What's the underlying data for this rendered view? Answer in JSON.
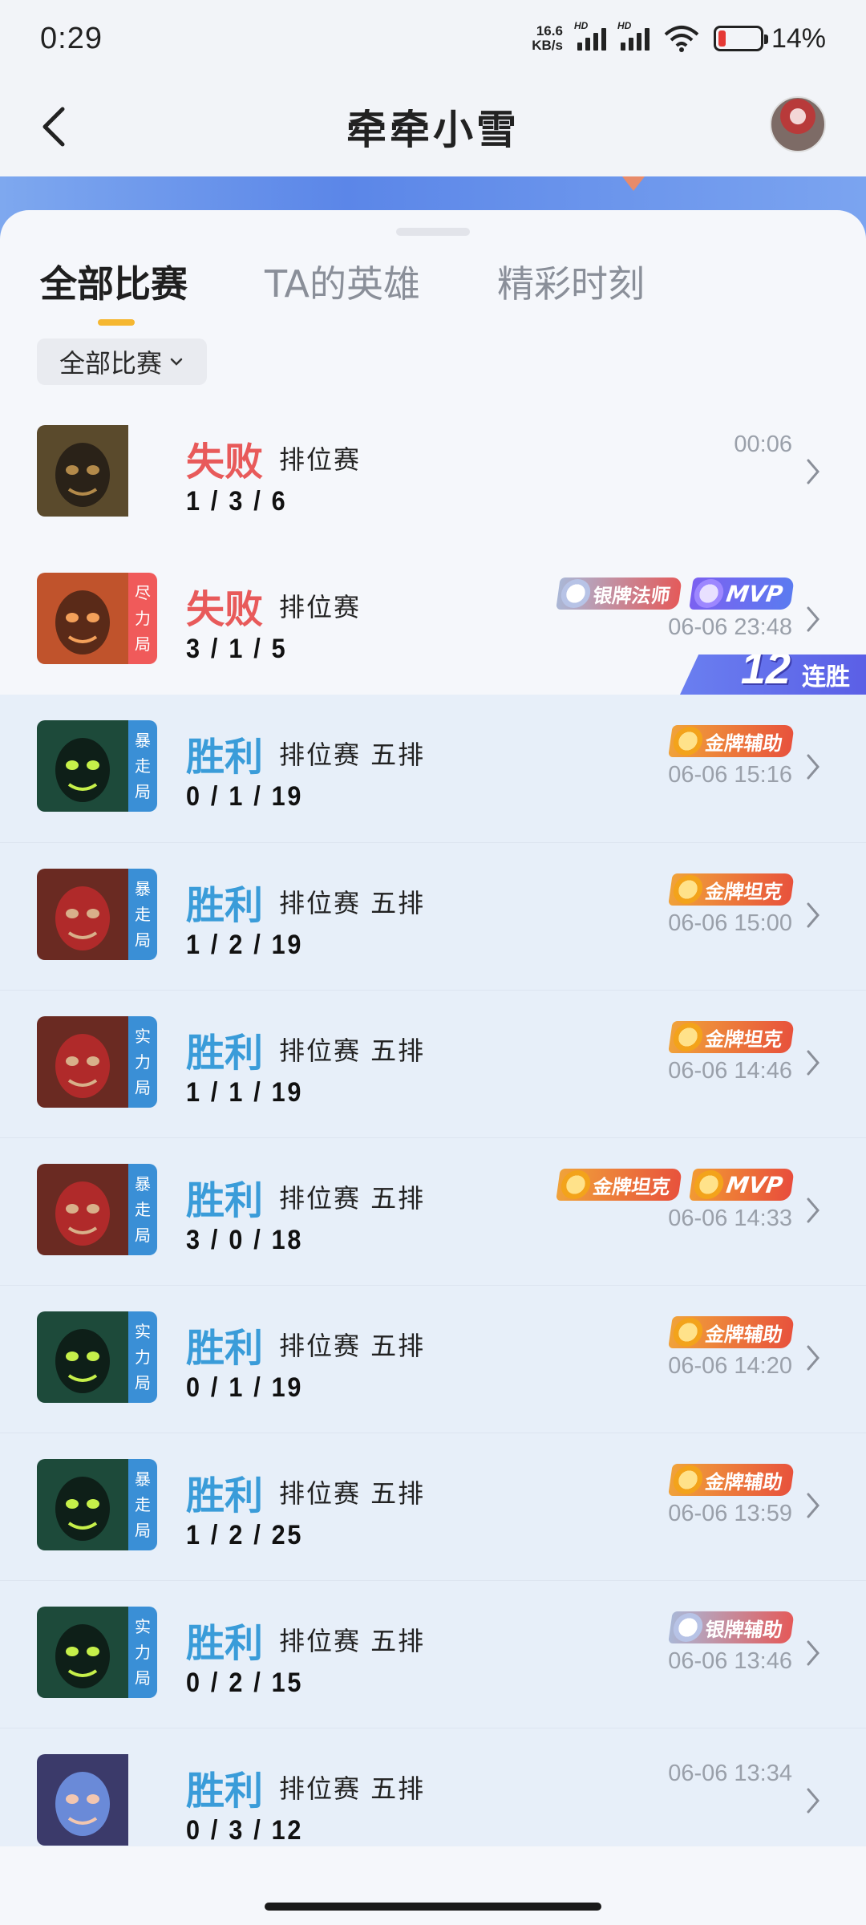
{
  "status_bar": {
    "time": "0:29",
    "net_speed_value": "16.6",
    "net_speed_unit": "KB/s",
    "signal_label": "HD",
    "battery_percent": "14%"
  },
  "header": {
    "title": "牵牵小雪"
  },
  "tabs": [
    {
      "label": "全部比赛",
      "active": true
    },
    {
      "label": "TA的英雄",
      "active": false
    },
    {
      "label": "精彩时刻",
      "active": false
    }
  ],
  "filter": {
    "selected": "全部比赛"
  },
  "streak": {
    "count": "12",
    "label": "连胜"
  },
  "matches": [
    {
      "result": "失败",
      "outcome": "loss",
      "mode": "排位赛",
      "kda": "1 / 3 / 6",
      "time": "00:06",
      "tag": [],
      "badges": []
    },
    {
      "result": "失败",
      "outcome": "loss",
      "mode": "排位赛",
      "kda": "3 / 1 / 5",
      "time": "06-06 23:48",
      "tag": [
        "尽",
        "力",
        "局"
      ],
      "badges": [
        "银牌法师",
        "MVP"
      ]
    },
    {
      "result": "胜利",
      "outcome": "win",
      "mode": "排位赛 五排",
      "kda": "0 / 1 / 19",
      "time": "06-06 15:16",
      "tag": [
        "暴",
        "走",
        "局"
      ],
      "badges": [
        "金牌辅助"
      ]
    },
    {
      "result": "胜利",
      "outcome": "win",
      "mode": "排位赛 五排",
      "kda": "1 / 2 / 19",
      "time": "06-06 15:00",
      "tag": [
        "暴",
        "走",
        "局"
      ],
      "badges": [
        "金牌坦克"
      ]
    },
    {
      "result": "胜利",
      "outcome": "win",
      "mode": "排位赛 五排",
      "kda": "1 / 1 / 19",
      "time": "06-06 14:46",
      "tag": [
        "实",
        "力",
        "局"
      ],
      "badges": [
        "金牌坦克"
      ]
    },
    {
      "result": "胜利",
      "outcome": "win",
      "mode": "排位赛 五排",
      "kda": "3 / 0 / 18",
      "time": "06-06 14:33",
      "tag": [
        "暴",
        "走",
        "局"
      ],
      "badges": [
        "金牌坦克",
        "MVP"
      ]
    },
    {
      "result": "胜利",
      "outcome": "win",
      "mode": "排位赛 五排",
      "kda": "0 / 1 / 19",
      "time": "06-06 14:20",
      "tag": [
        "实",
        "力",
        "局"
      ],
      "badges": [
        "金牌辅助"
      ]
    },
    {
      "result": "胜利",
      "outcome": "win",
      "mode": "排位赛 五排",
      "kda": "1 / 2 / 25",
      "time": "06-06 13:59",
      "tag": [
        "暴",
        "走",
        "局"
      ],
      "badges": [
        "金牌辅助"
      ]
    },
    {
      "result": "胜利",
      "outcome": "win",
      "mode": "排位赛 五排",
      "kda": "0 / 2 / 15",
      "time": "06-06 13:46",
      "tag": [
        "实",
        "力",
        "局"
      ],
      "badges": [
        "银牌辅助"
      ]
    },
    {
      "result": "胜利",
      "outcome": "win",
      "mode": "排位赛 五排",
      "kda": "0 / 3 / 12",
      "time": "06-06 13:34",
      "tag": [],
      "badges": []
    }
  ],
  "colors": {
    "loss": "#e85a5a",
    "win": "#3a9cd9",
    "tab_underline": "#f5b731",
    "win_row_bg": "#e7eff9"
  }
}
